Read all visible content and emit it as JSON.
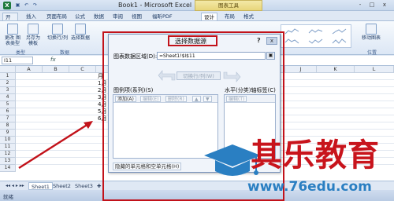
{
  "window": {
    "title": "Book1 - Microsoft Excel",
    "context_tools": "图表工具",
    "controls": [
      "-",
      "□",
      "x"
    ]
  },
  "ribbon": {
    "tabs": [
      "开始",
      "插入",
      "页面布局",
      "公式",
      "数据",
      "审阅",
      "视图",
      "福昕PDF",
      "设计",
      "布局",
      "格式"
    ],
    "active_tab": "设计",
    "buttons": {
      "change_chart_type": "更改\n图表类型",
      "save_as_template": "另存为\n模板",
      "switch_row_col": "切换行/列",
      "select_data": "选择数据",
      "move_chart": "移动图表"
    },
    "groups": {
      "type": "类型",
      "data": "数据",
      "location": "位置"
    }
  },
  "formula_bar": {
    "name_box": "I11",
    "fx": "fx"
  },
  "grid": {
    "columns": [
      "A",
      "B",
      "C",
      "D",
      "E",
      "F",
      "G",
      "H",
      "I",
      "J",
      "K",
      "L"
    ],
    "rows": [
      "1",
      "2",
      "3",
      "4",
      "5",
      "6",
      "7",
      "8",
      "9",
      "10",
      "11",
      "12",
      "13",
      "14"
    ],
    "c_cells": [
      "月",
      "1月",
      "2月",
      "3月",
      "4月",
      "5月",
      "6月"
    ]
  },
  "sheets": {
    "tabs": [
      "Sheet1",
      "Sheet2",
      "Sheet3"
    ]
  },
  "status": {
    "ready": "就绪"
  },
  "dialog": {
    "title": "选择数据源",
    "help": "?",
    "close": "x",
    "range_label": "图表数据区域(D):",
    "range_value": "=Sheet1!$I$11",
    "switch_button": "切换行/列(W)",
    "series_label": "图例项(系列)(S)",
    "series_buttons": [
      "添加(A)",
      "编辑(E)",
      "删除(R)"
    ],
    "axis_label": "水平(分类)轴标签(C)",
    "axis_buttons": [
      "编辑(T)"
    ],
    "hidden_cells_button": "隐藏的单元格和空单元格(H)"
  },
  "watermark": {
    "title": "其乐教育",
    "url": "www.76edu.com"
  },
  "colors": {
    "annotation_red": "#c2121a",
    "watermark_red": "#c8141c",
    "watermark_blue": "#2a7fc2"
  }
}
